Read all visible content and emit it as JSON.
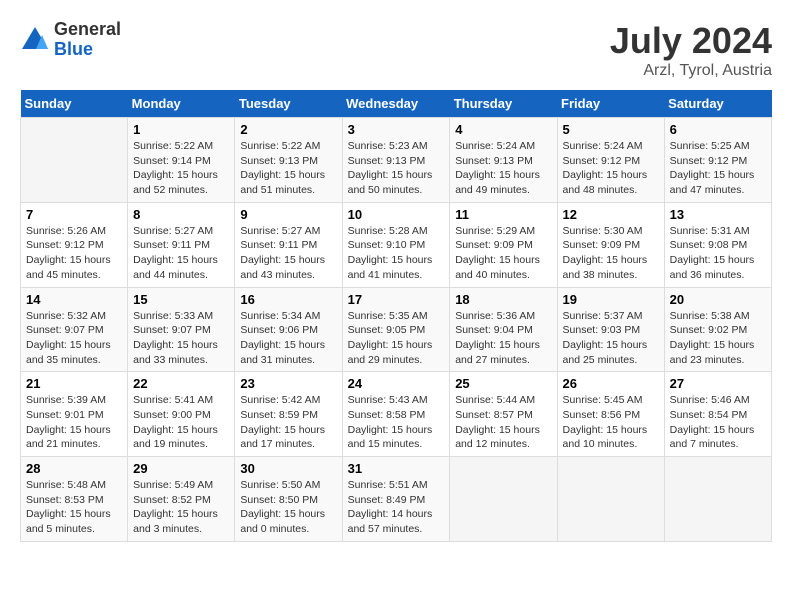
{
  "header": {
    "logo_general": "General",
    "logo_blue": "Blue",
    "title": "July 2024",
    "subtitle": "Arzl, Tyrol, Austria"
  },
  "columns": [
    "Sunday",
    "Monday",
    "Tuesday",
    "Wednesday",
    "Thursday",
    "Friday",
    "Saturday"
  ],
  "weeks": [
    {
      "days": [
        {
          "num": "",
          "info": ""
        },
        {
          "num": "1",
          "info": "Sunrise: 5:22 AM\nSunset: 9:14 PM\nDaylight: 15 hours\nand 52 minutes."
        },
        {
          "num": "2",
          "info": "Sunrise: 5:22 AM\nSunset: 9:13 PM\nDaylight: 15 hours\nand 51 minutes."
        },
        {
          "num": "3",
          "info": "Sunrise: 5:23 AM\nSunset: 9:13 PM\nDaylight: 15 hours\nand 50 minutes."
        },
        {
          "num": "4",
          "info": "Sunrise: 5:24 AM\nSunset: 9:13 PM\nDaylight: 15 hours\nand 49 minutes."
        },
        {
          "num": "5",
          "info": "Sunrise: 5:24 AM\nSunset: 9:12 PM\nDaylight: 15 hours\nand 48 minutes."
        },
        {
          "num": "6",
          "info": "Sunrise: 5:25 AM\nSunset: 9:12 PM\nDaylight: 15 hours\nand 47 minutes."
        }
      ]
    },
    {
      "days": [
        {
          "num": "7",
          "info": "Sunrise: 5:26 AM\nSunset: 9:12 PM\nDaylight: 15 hours\nand 45 minutes."
        },
        {
          "num": "8",
          "info": "Sunrise: 5:27 AM\nSunset: 9:11 PM\nDaylight: 15 hours\nand 44 minutes."
        },
        {
          "num": "9",
          "info": "Sunrise: 5:27 AM\nSunset: 9:11 PM\nDaylight: 15 hours\nand 43 minutes."
        },
        {
          "num": "10",
          "info": "Sunrise: 5:28 AM\nSunset: 9:10 PM\nDaylight: 15 hours\nand 41 minutes."
        },
        {
          "num": "11",
          "info": "Sunrise: 5:29 AM\nSunset: 9:09 PM\nDaylight: 15 hours\nand 40 minutes."
        },
        {
          "num": "12",
          "info": "Sunrise: 5:30 AM\nSunset: 9:09 PM\nDaylight: 15 hours\nand 38 minutes."
        },
        {
          "num": "13",
          "info": "Sunrise: 5:31 AM\nSunset: 9:08 PM\nDaylight: 15 hours\nand 36 minutes."
        }
      ]
    },
    {
      "days": [
        {
          "num": "14",
          "info": "Sunrise: 5:32 AM\nSunset: 9:07 PM\nDaylight: 15 hours\nand 35 minutes."
        },
        {
          "num": "15",
          "info": "Sunrise: 5:33 AM\nSunset: 9:07 PM\nDaylight: 15 hours\nand 33 minutes."
        },
        {
          "num": "16",
          "info": "Sunrise: 5:34 AM\nSunset: 9:06 PM\nDaylight: 15 hours\nand 31 minutes."
        },
        {
          "num": "17",
          "info": "Sunrise: 5:35 AM\nSunset: 9:05 PM\nDaylight: 15 hours\nand 29 minutes."
        },
        {
          "num": "18",
          "info": "Sunrise: 5:36 AM\nSunset: 9:04 PM\nDaylight: 15 hours\nand 27 minutes."
        },
        {
          "num": "19",
          "info": "Sunrise: 5:37 AM\nSunset: 9:03 PM\nDaylight: 15 hours\nand 25 minutes."
        },
        {
          "num": "20",
          "info": "Sunrise: 5:38 AM\nSunset: 9:02 PM\nDaylight: 15 hours\nand 23 minutes."
        }
      ]
    },
    {
      "days": [
        {
          "num": "21",
          "info": "Sunrise: 5:39 AM\nSunset: 9:01 PM\nDaylight: 15 hours\nand 21 minutes."
        },
        {
          "num": "22",
          "info": "Sunrise: 5:41 AM\nSunset: 9:00 PM\nDaylight: 15 hours\nand 19 minutes."
        },
        {
          "num": "23",
          "info": "Sunrise: 5:42 AM\nSunset: 8:59 PM\nDaylight: 15 hours\nand 17 minutes."
        },
        {
          "num": "24",
          "info": "Sunrise: 5:43 AM\nSunset: 8:58 PM\nDaylight: 15 hours\nand 15 minutes."
        },
        {
          "num": "25",
          "info": "Sunrise: 5:44 AM\nSunset: 8:57 PM\nDaylight: 15 hours\nand 12 minutes."
        },
        {
          "num": "26",
          "info": "Sunrise: 5:45 AM\nSunset: 8:56 PM\nDaylight: 15 hours\nand 10 minutes."
        },
        {
          "num": "27",
          "info": "Sunrise: 5:46 AM\nSunset: 8:54 PM\nDaylight: 15 hours\nand 7 minutes."
        }
      ]
    },
    {
      "days": [
        {
          "num": "28",
          "info": "Sunrise: 5:48 AM\nSunset: 8:53 PM\nDaylight: 15 hours\nand 5 minutes."
        },
        {
          "num": "29",
          "info": "Sunrise: 5:49 AM\nSunset: 8:52 PM\nDaylight: 15 hours\nand 3 minutes."
        },
        {
          "num": "30",
          "info": "Sunrise: 5:50 AM\nSunset: 8:50 PM\nDaylight: 15 hours\nand 0 minutes."
        },
        {
          "num": "31",
          "info": "Sunrise: 5:51 AM\nSunset: 8:49 PM\nDaylight: 14 hours\nand 57 minutes."
        },
        {
          "num": "",
          "info": ""
        },
        {
          "num": "",
          "info": ""
        },
        {
          "num": "",
          "info": ""
        }
      ]
    }
  ]
}
